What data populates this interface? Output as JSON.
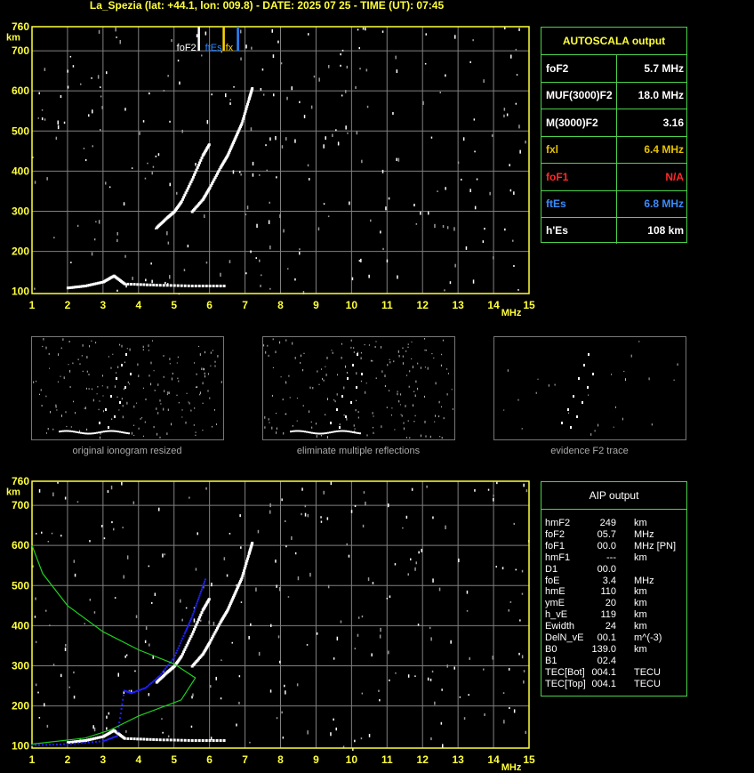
{
  "title": "La_Spezia (lat: +44.1, lon: 009.8) - DATE: 2025 07 25 - TIME (UT): 07:45",
  "colors": {
    "axis": "#ffff3c",
    "grid": "#808080",
    "panel_border": "#4cd24c",
    "foEs_line": "#2b86ff",
    "fx_line": "#ffd400",
    "profile": "#1fd01f",
    "aip_trace": "#2020ff"
  },
  "ionogram_top": {
    "y_unit": "km",
    "x_unit": "MHz",
    "x_ticks": [
      "1",
      "2",
      "3",
      "4",
      "5",
      "6",
      "7",
      "8",
      "9",
      "10",
      "11",
      "12",
      "13",
      "14",
      "15"
    ],
    "y_ticks": [
      "100",
      "200",
      "300",
      "400",
      "500",
      "600",
      "700",
      "760"
    ],
    "markers": {
      "foF2_label": "foF2",
      "ftEs_label": "ftEs",
      "fx_label": "fx"
    }
  },
  "thumbnails": [
    {
      "caption": "original ionogram resized"
    },
    {
      "caption": "eliminate multiple reflections"
    },
    {
      "caption": "evidence F2 trace"
    }
  ],
  "ionogram_bottom": {
    "y_unit": "km",
    "x_unit": "MHz",
    "x_ticks": [
      "1",
      "2",
      "3",
      "4",
      "5",
      "6",
      "7",
      "8",
      "9",
      "10",
      "11",
      "12",
      "13",
      "14",
      "15"
    ],
    "y_ticks": [
      "100",
      "200",
      "300",
      "400",
      "500",
      "600",
      "700",
      "760"
    ]
  },
  "autoscala": {
    "header": "AUTOSCALA output",
    "rows": [
      {
        "label": "foF2",
        "value": "5.7 MHz",
        "color": "#ffffff"
      },
      {
        "label": "MUF(3000)F2",
        "value": "18.0 MHz",
        "color": "#ffffff"
      },
      {
        "label": "M(3000)F2",
        "value": "3.16",
        "color": "#ffffff"
      },
      {
        "label": "fxl",
        "value": "6.4 MHz",
        "color": "#e6c200"
      },
      {
        "label": "foF1",
        "value": "N/A",
        "color": "#ff2a2a"
      },
      {
        "label": "ftEs",
        "value": "6.8 MHz",
        "color": "#3a8cff"
      },
      {
        "label": "h'Es",
        "value": "108    km",
        "color": "#ffffff"
      }
    ]
  },
  "aip": {
    "header": "AIP output",
    "rows": [
      {
        "name": "hmF2",
        "value": "249",
        "unit": "km"
      },
      {
        "name": "foF2",
        "value": "05.7",
        "unit": "MHz"
      },
      {
        "name": "foF1",
        "value": "00.0",
        "unit": "MHz   [PN]"
      },
      {
        "name": "hmF1",
        "value": "---",
        "unit": "km"
      },
      {
        "name": "D1",
        "value": "00.0",
        "unit": ""
      },
      {
        "name": "foE",
        "value": "3.4",
        "unit": "MHz"
      },
      {
        "name": "hmE",
        "value": "110",
        "unit": "km"
      },
      {
        "name": "ymE",
        "value": "20",
        "unit": "km"
      },
      {
        "name": "h_vE",
        "value": "119",
        "unit": "km"
      },
      {
        "name": "Ewidth",
        "value": "24",
        "unit": "km"
      },
      {
        "name": "DelN_vE",
        "value": "00.1",
        "unit": "m^(-3)"
      },
      {
        "name": "B0",
        "value": "139.0",
        "unit": "km"
      },
      {
        "name": "B1",
        "value": "02.4",
        "unit": ""
      },
      {
        "name": "TEC[Bot]",
        "value": "004.1",
        "unit": "TECU"
      },
      {
        "name": "TEC[Top]",
        "value": "004.1",
        "unit": "TECU"
      }
    ]
  },
  "chart_data": [
    {
      "type": "scatter",
      "title": "",
      "xlabel": "MHz",
      "ylabel": "km",
      "xlim": [
        1,
        15
      ],
      "ylim": [
        95,
        760
      ],
      "grid": true,
      "series": [
        {
          "name": "",
          "points": [
            [
              2.0,
              110
            ],
            [
              2.5,
              115
            ],
            [
              3.0,
              125
            ],
            [
              3.3,
              140
            ],
            [
              3.6,
              120
            ],
            [
              4.5,
              117
            ],
            [
              5.5,
              115
            ],
            [
              6.5,
              115
            ]
          ]
        },
        {
          "name": "",
          "points": [
            [
              4.5,
              260
            ],
            [
              4.8,
              285
            ],
            [
              5.0,
              300
            ],
            [
              5.2,
              325
            ],
            [
              5.5,
              380
            ],
            [
              5.8,
              440
            ],
            [
              6.0,
              470
            ]
          ]
        },
        {
          "name": "",
          "points": [
            [
              5.5,
              300
            ],
            [
              5.8,
              330
            ],
            [
              6.0,
              360
            ],
            [
              6.3,
              410
            ],
            [
              6.5,
              440
            ],
            [
              6.7,
              480
            ],
            [
              6.9,
              520
            ],
            [
              7.1,
              580
            ],
            [
              7.2,
              610
            ]
          ]
        }
      ],
      "vertical_markers": [
        {
          "label": "foF2",
          "x": 5.7
        },
        {
          "label": "fx",
          "x": 6.4
        },
        {
          "label": "ftEs",
          "x": 6.8
        }
      ]
    },
    {
      "type": "scatter",
      "title": "",
      "xlabel": "MHz",
      "ylabel": "km",
      "xlim": [
        1,
        15
      ],
      "ylim": [
        95,
        760
      ],
      "grid": true,
      "series": [
        {
          "name": "",
          "points": [
            [
              2.0,
              110
            ],
            [
              2.5,
              115
            ],
            [
              3.0,
              125
            ],
            [
              3.3,
              140
            ],
            [
              3.6,
              120
            ],
            [
              4.5,
              117
            ],
            [
              5.5,
              115
            ],
            [
              6.5,
              115
            ]
          ]
        },
        {
          "name": "",
          "points": [
            [
              4.5,
              260
            ],
            [
              4.8,
              285
            ],
            [
              5.0,
              300
            ],
            [
              5.2,
              325
            ],
            [
              5.5,
              380
            ],
            [
              5.8,
              440
            ],
            [
              6.0,
              470
            ]
          ]
        },
        {
          "name": "",
          "points": [
            [
              5.5,
              300
            ],
            [
              5.8,
              330
            ],
            [
              6.0,
              360
            ],
            [
              6.3,
              410
            ],
            [
              6.5,
              440
            ],
            [
              6.7,
              480
            ],
            [
              6.9,
              520
            ],
            [
              7.1,
              580
            ],
            [
              7.2,
              610
            ]
          ]
        },
        {
          "name": "",
          "points": [
            [
              1.0,
              102
            ],
            [
              2.0,
              105
            ],
            [
              3.0,
              112
            ],
            [
              3.4,
              125
            ],
            [
              3.6,
              238
            ],
            [
              3.8,
              232
            ],
            [
              4.2,
              245
            ],
            [
              4.6,
              275
            ],
            [
              5.0,
              320
            ],
            [
              5.3,
              380
            ],
            [
              5.5,
              420
            ],
            [
              5.7,
              470
            ],
            [
              5.9,
              520
            ]
          ]
        },
        {
          "name": "",
          "points": [
            [
              1.0,
              600
            ],
            [
              1.3,
              530
            ],
            [
              2.0,
              450
            ],
            [
              3.0,
              385
            ],
            [
              4.0,
              340
            ],
            [
              5.0,
              305
            ],
            [
              5.6,
              270
            ],
            [
              5.2,
              215
            ],
            [
              4.0,
              175
            ],
            [
              3.2,
              140
            ],
            [
              2.5,
              120
            ],
            [
              1.0,
              105
            ]
          ]
        }
      ]
    }
  ]
}
